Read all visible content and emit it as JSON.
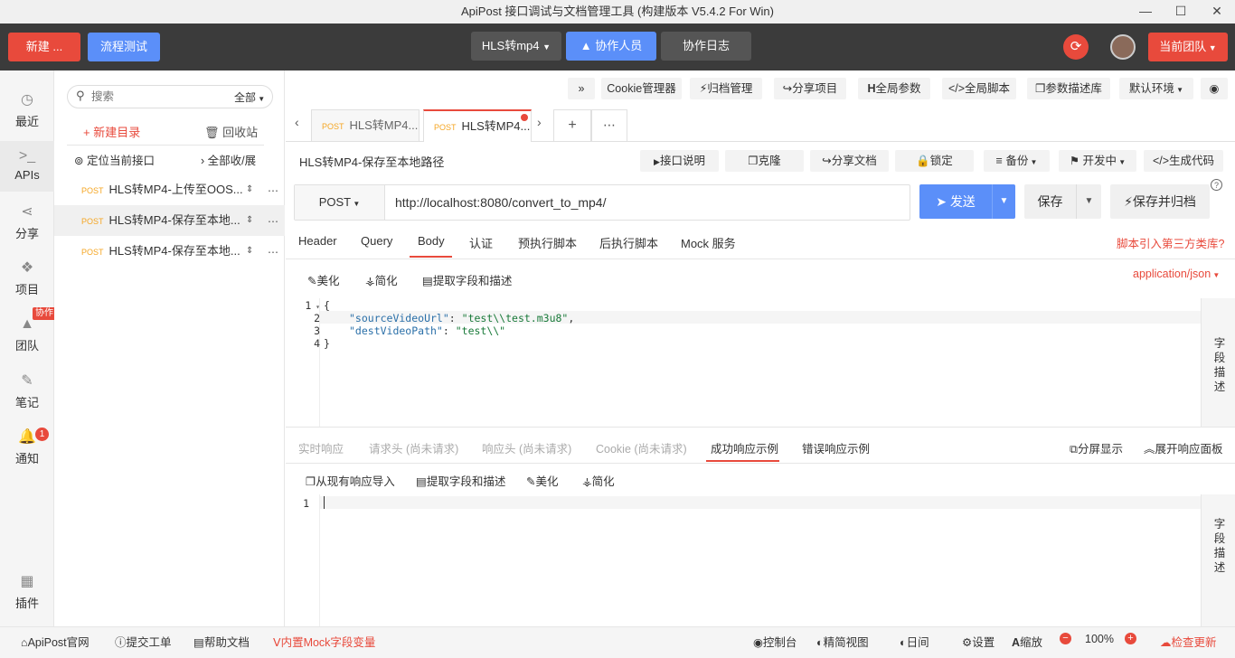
{
  "window": {
    "title": "ApiPost 接口调试与文档管理工具 (构建版本 V5.4.2 For Win)",
    "min": "—",
    "max": "☐",
    "close": "✕"
  },
  "topbar": {
    "new_label": "新建 ...",
    "flow_label": "流程测试",
    "project_label": "HLS转mp4",
    "collab_label": "协作人员",
    "log_label": "协作日志",
    "team_label": "当前团队"
  },
  "leftnav": {
    "items": [
      {
        "label": "最近",
        "icon": "◷"
      },
      {
        "label": "APIs",
        "icon": ">_"
      },
      {
        "label": "分享",
        "icon": "⋖"
      },
      {
        "label": "项目",
        "icon": "❖"
      },
      {
        "label": "团队",
        "icon": "▲",
        "badge": "协作"
      },
      {
        "label": "笔记",
        "icon": "✎"
      },
      {
        "label": "通知",
        "icon": "🔔",
        "badge": "1"
      },
      {
        "label": "插件",
        "icon": "▦"
      }
    ]
  },
  "sidebar": {
    "search_placeholder": "搜索",
    "filter_label": "全部",
    "new_dir_label": "新建目录",
    "trash_label": "回收站",
    "locate_label": "定位当前接口",
    "collapse_label": "全部收/展",
    "method": "POST",
    "items": [
      {
        "label": "HLS转MP4-上传至OOS..."
      },
      {
        "label": "HLS转MP4-保存至本地..."
      },
      {
        "label": "HLS转MP4-保存至本地..."
      }
    ]
  },
  "toolbar": {
    "more": "»",
    "cookie": "Cookie管理器",
    "archive": "归档管理",
    "share_project": "分享项目",
    "global_params": "全局参数",
    "global_script": "全局脚本",
    "param_lib": "参数描述库",
    "env": "默认环境",
    "eye": "◉"
  },
  "tabs": [
    {
      "method": "POST",
      "label": "HLS转MP4..."
    },
    {
      "method": "POST",
      "label": "HLS转MP4..."
    }
  ],
  "request": {
    "name": "HLS转MP4-保存至本地路径",
    "actions": {
      "doc": "接口说明",
      "clone": "克隆",
      "share_doc": "分享文档",
      "lock": "锁定",
      "backup": "备份",
      "status": "开发中",
      "gen_code": "生成代码"
    },
    "method": "POST",
    "url": "http://localhost:8080/convert_to_mp4/",
    "send": "发送",
    "save": "保存",
    "save_archive": "保存并归档",
    "help": "?",
    "req_tabs": [
      "Header",
      "Query",
      "Body",
      "认证",
      "预执行脚本",
      "后执行脚本",
      "Mock 服务"
    ],
    "script_link": "脚本引入第三方类库?",
    "body_tools": {
      "beautify": "美化",
      "simplify": "简化",
      "extract": "提取字段和描述"
    },
    "content_type": "application/json",
    "body_lines": [
      {
        "no": "1",
        "text": "{"
      },
      {
        "no": "2",
        "key": "\"sourceVideoUrl\"",
        "value": "\"test\\\\test.m3u8\"",
        "tail": ","
      },
      {
        "no": "3",
        "key": "\"destVideoPath\"",
        "value": "\"test\\\\\"",
        "tail": ""
      },
      {
        "no": "4",
        "text": "}"
      }
    ],
    "field_desc": "字段描述"
  },
  "response": {
    "tabs": [
      "实时响应",
      "请求头 (尚未请求)",
      "响应头 (尚未请求)",
      "Cookie (尚未请求)",
      "成功响应示例",
      "错误响应示例"
    ],
    "split": "分屏显示",
    "expand": "展开响应面板",
    "tools": {
      "import": "从现有响应导入",
      "extract": "提取字段和描述",
      "beautify": "美化",
      "simplify": "简化"
    },
    "line_no": "1",
    "field_desc": "字段描述"
  },
  "statusbar": {
    "website": "ApiPost官网",
    "ticket": "提交工单",
    "help": "帮助文档",
    "mock": "内置Mock字段变量",
    "console": "控制台",
    "simple_view": "精简视图",
    "daynight": "日间",
    "settings": "设置",
    "zoom_label": "缩放",
    "zoom": "100%",
    "update": "检查更新"
  }
}
